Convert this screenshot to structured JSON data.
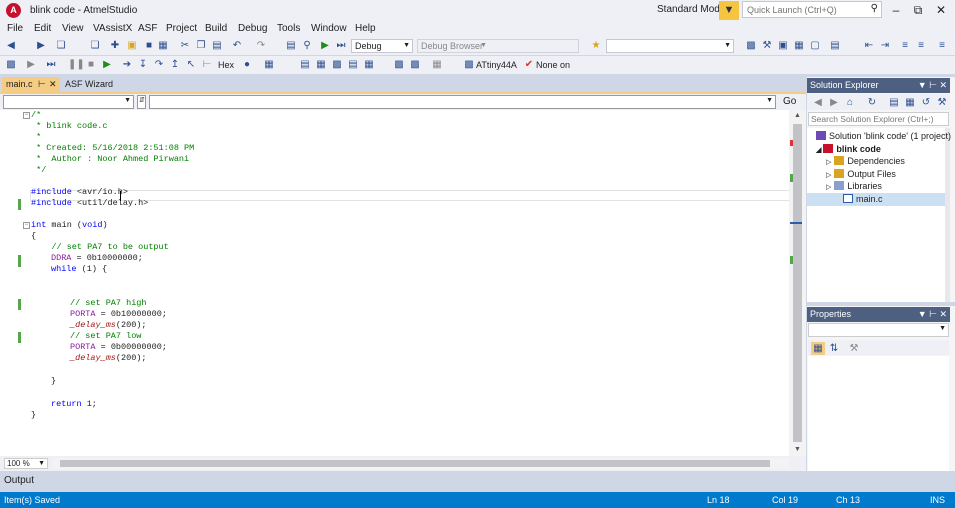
{
  "window": {
    "title": "blink code - AtmelStudio",
    "mode": "Standard Mode",
    "quick_launch_placeholder": "Quick Launch (Ctrl+Q)",
    "min": "–",
    "max": "⧉",
    "close": "✕"
  },
  "menu": [
    "File",
    "Edit",
    "View",
    "VAssistX",
    "ASF",
    "Project",
    "Build",
    "Debug",
    "Tools",
    "Window",
    "Help"
  ],
  "toolbar": {
    "config": "Debug",
    "debug_browser": "Debug Browser",
    "hex": "Hex",
    "device": "ATtiny44A",
    "tool": "None on"
  },
  "tabs": {
    "main": "main.c",
    "asf": "ASF Wizard"
  },
  "nav": {
    "go": "Go"
  },
  "code": {
    "l1": "/*",
    "l2": " * blink code.c",
    "l3": " *",
    "l4": " * Created: 5/16/2018 2:51:08 PM",
    "l5": " *  Author : Noor Ahmed Pirwani",
    "l6": " */",
    "inc1_kw": "#include",
    "inc1_file": " <avr/io.h>",
    "inc2_kw": "#include",
    "inc2_file": " <util/delay.h>",
    "main_int": "int",
    "main_name": " main (",
    "main_void": "void",
    "main_close": ")",
    "brace_open": "{",
    "c1": "    // set PA7 to be output",
    "ddra": "DDRA",
    "ddra_val": " = 0b10000000;",
    "while_kw": "while",
    "while_rest": " (1) {",
    "c2": "// set PA7 high",
    "porta1": "PORTA",
    "porta1_val": " = 0b10000000;",
    "delay1": "_delay_ms",
    "delay1_arg": "(200);",
    "c3": "// set PA7 low",
    "porta2": "PORTA",
    "porta2_val": " = 0b00000000;",
    "delay2": "_delay_ms",
    "delay2_arg": "(200);",
    "inner_close": "}",
    "return_kw": "return",
    "return_rest": " 1;",
    "brace_close": "}"
  },
  "zoom": "100 %",
  "solution_explorer": {
    "title": "Solution Explorer",
    "search_placeholder": "Search Solution Explorer (Ctrl+;)",
    "solution": "Solution 'blink code' (1 project)",
    "project": "blink code",
    "items": [
      "Dependencies",
      "Output Files",
      "Libraries",
      "main.c"
    ]
  },
  "properties": {
    "title": "Properties"
  },
  "output": {
    "title": "Output"
  },
  "status": {
    "message": "Item(s) Saved",
    "ln": "Ln 18",
    "col": "Col 19",
    "ch": "Ch 13",
    "ins": "INS"
  }
}
